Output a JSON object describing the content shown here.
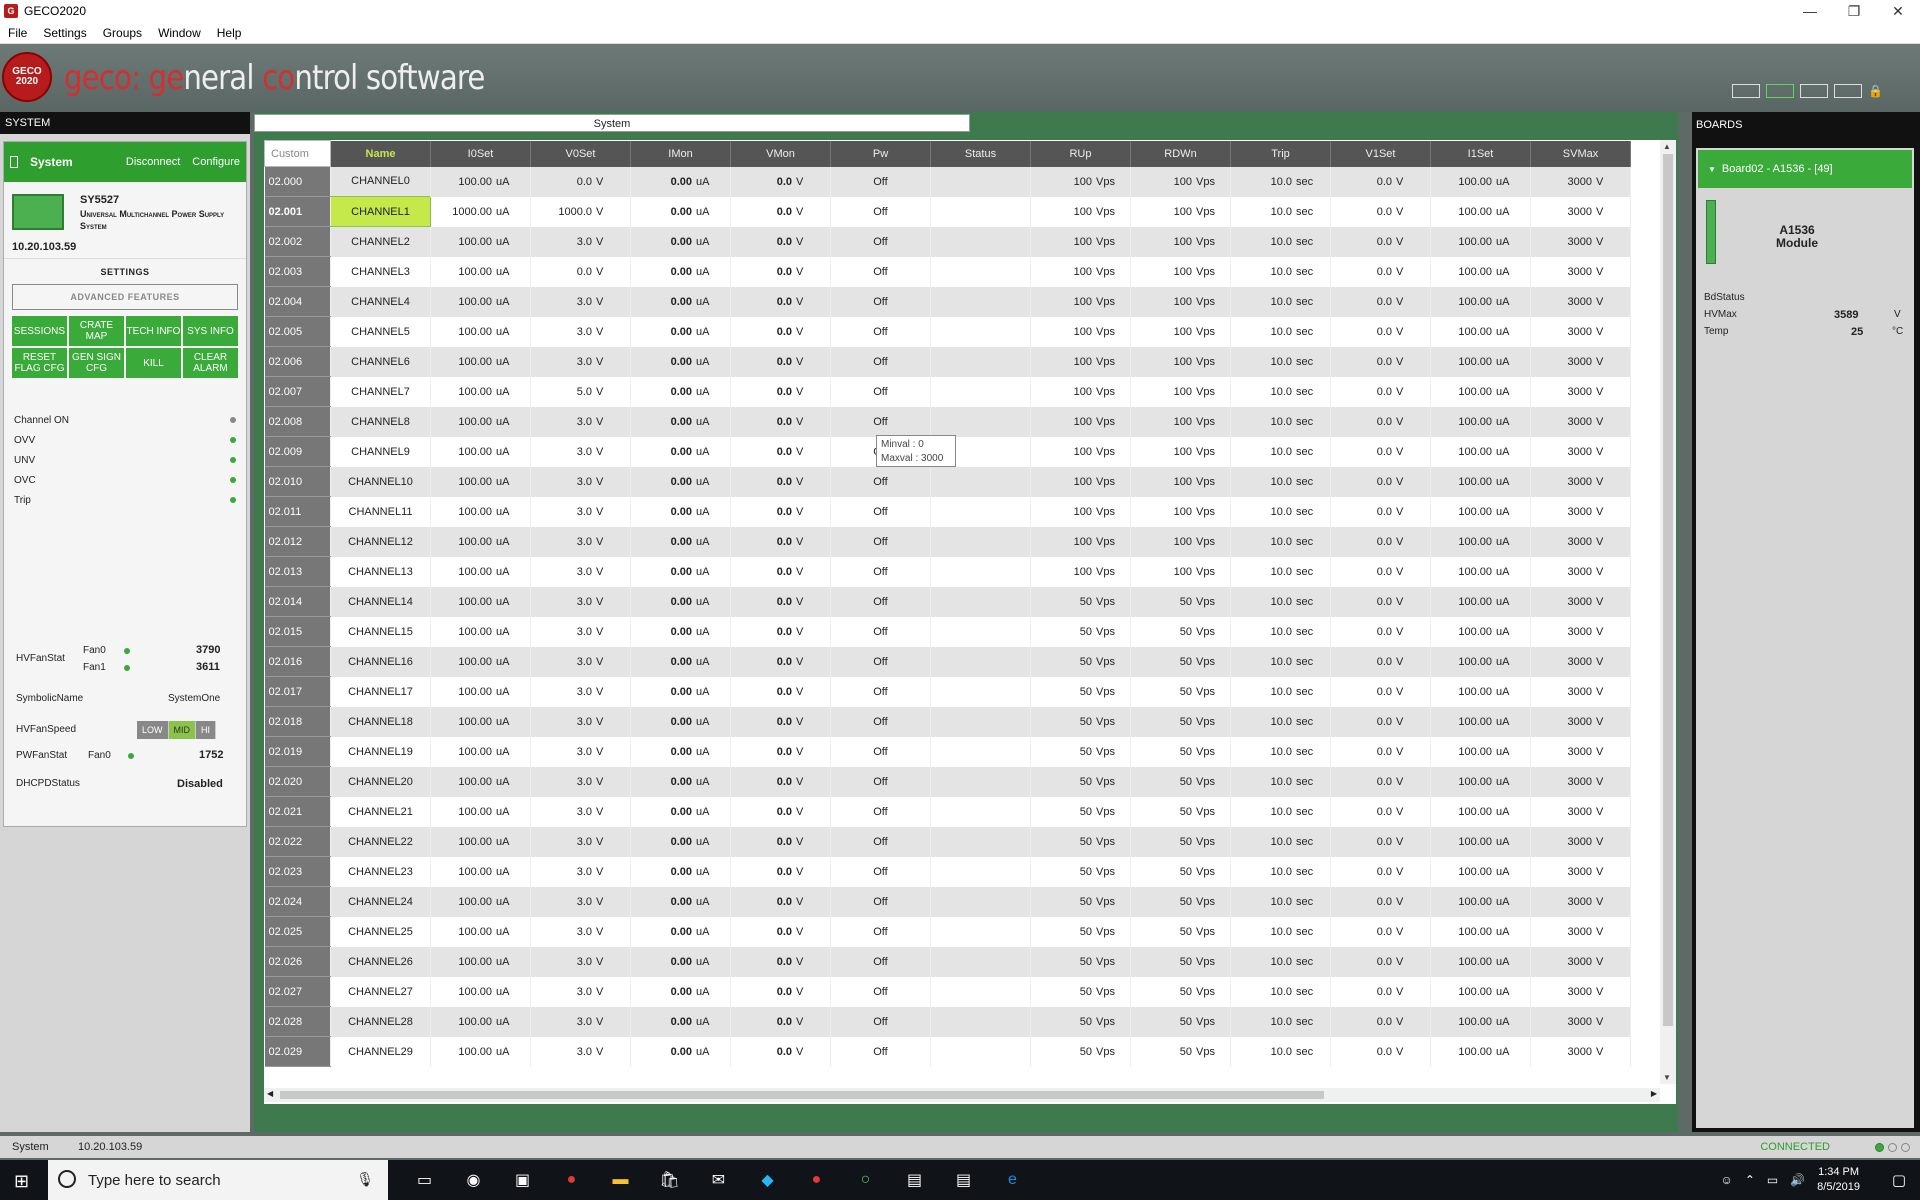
{
  "window": {
    "title": "GECO2020",
    "app_icon": "geco-app-icon"
  },
  "menu": [
    "File",
    "Settings",
    "Groups",
    "Window",
    "Help"
  ],
  "banner": {
    "logo_text": "GECO 2020",
    "title_a": "geco: ge",
    "title_b": "neral ",
    "title_c": "co",
    "title_d": "ntrol software"
  },
  "left": {
    "panel_title": "SYSTEM",
    "system_name": "System",
    "disconnect": "Disconnect",
    "configure": "Configure",
    "model": "SY5527",
    "model_desc": "Universal Multichannel Power Supply System",
    "ip": "10.20.103.59",
    "settings": "SETTINGS",
    "advanced": "ADVANCED FEATURES",
    "buttons": [
      "SESSIONS",
      "CRATE MAP",
      "TECH INFO",
      "SYS INFO",
      "RESET FLAG CFG",
      "GEN SIGN CFG",
      "KILL",
      "CLEAR ALARM"
    ],
    "flags": [
      "Channel ON",
      "OVV",
      "UNV",
      "OVC",
      "Trip"
    ],
    "hvfanstat": "HVFanStat",
    "fan0": "Fan0",
    "fan0_val": "3790",
    "fan1": "Fan1",
    "fan1_val": "3611",
    "symbolic_name_label": "SymbolicName",
    "symbolic_name": "SystemOne",
    "hvfanspeed": "HVFanSpeed",
    "speeds": [
      "LOW",
      "MID",
      "HI"
    ],
    "pwfanstat": "PWFanStat",
    "pw_fan0": "Fan0",
    "pw_fan0_val": "1752",
    "dhcp_label": "DHCPDStatus",
    "dhcp": "Disabled"
  },
  "center": {
    "tab": "System",
    "custom_placeholder": "Custom",
    "columns": [
      "Name",
      "I0Set",
      "V0Set",
      "IMon",
      "VMon",
      "Pw",
      "Status",
      "RUp",
      "RDWn",
      "Trip",
      "V1Set",
      "I1Set",
      "SVMax"
    ],
    "tooltip": [
      "Minval : 0",
      "Maxval : 3000"
    ],
    "rows": [
      [
        "02.000",
        "CHANNEL0",
        "100.00",
        "uA",
        "0.0",
        "V",
        "0.00",
        "uA",
        "0.0",
        "V",
        "Off",
        "",
        "100",
        "Vps",
        "100",
        "Vps",
        "10.0",
        "sec",
        "0.0",
        "V",
        "100.00",
        "uA",
        "3000",
        "V"
      ],
      [
        "02.001",
        "CHANNEL1",
        "1000.00",
        "uA",
        "1000.0",
        "V",
        "0.00",
        "uA",
        "0.0",
        "V",
        "Off",
        "",
        "100",
        "Vps",
        "100",
        "Vps",
        "10.0",
        "sec",
        "0.0",
        "V",
        "100.00",
        "uA",
        "3000",
        "V"
      ],
      [
        "02.002",
        "CHANNEL2",
        "100.00",
        "uA",
        "3.0",
        "V",
        "0.00",
        "uA",
        "0.0",
        "V",
        "Off",
        "",
        "100",
        "Vps",
        "100",
        "Vps",
        "10.0",
        "sec",
        "0.0",
        "V",
        "100.00",
        "uA",
        "3000",
        "V"
      ],
      [
        "02.003",
        "CHANNEL3",
        "100.00",
        "uA",
        "0.0",
        "V",
        "0.00",
        "uA",
        "0.0",
        "V",
        "Off",
        "",
        "100",
        "Vps",
        "100",
        "Vps",
        "10.0",
        "sec",
        "0.0",
        "V",
        "100.00",
        "uA",
        "3000",
        "V"
      ],
      [
        "02.004",
        "CHANNEL4",
        "100.00",
        "uA",
        "3.0",
        "V",
        "0.00",
        "uA",
        "0.0",
        "V",
        "Off",
        "",
        "100",
        "Vps",
        "100",
        "Vps",
        "10.0",
        "sec",
        "0.0",
        "V",
        "100.00",
        "uA",
        "3000",
        "V"
      ],
      [
        "02.005",
        "CHANNEL5",
        "100.00",
        "uA",
        "3.0",
        "V",
        "0.00",
        "uA",
        "0.0",
        "V",
        "Off",
        "",
        "100",
        "Vps",
        "100",
        "Vps",
        "10.0",
        "sec",
        "0.0",
        "V",
        "100.00",
        "uA",
        "3000",
        "V"
      ],
      [
        "02.006",
        "CHANNEL6",
        "100.00",
        "uA",
        "3.0",
        "V",
        "0.00",
        "uA",
        "0.0",
        "V",
        "Off",
        "",
        "100",
        "Vps",
        "100",
        "Vps",
        "10.0",
        "sec",
        "0.0",
        "V",
        "100.00",
        "uA",
        "3000",
        "V"
      ],
      [
        "02.007",
        "CHANNEL7",
        "100.00",
        "uA",
        "5.0",
        "V",
        "0.00",
        "uA",
        "0.0",
        "V",
        "Off",
        "",
        "100",
        "Vps",
        "100",
        "Vps",
        "10.0",
        "sec",
        "0.0",
        "V",
        "100.00",
        "uA",
        "3000",
        "V"
      ],
      [
        "02.008",
        "CHANNEL8",
        "100.00",
        "uA",
        "3.0",
        "V",
        "0.00",
        "uA",
        "0.0",
        "V",
        "Off",
        "",
        "100",
        "Vps",
        "100",
        "Vps",
        "10.0",
        "sec",
        "0.0",
        "V",
        "100.00",
        "uA",
        "3000",
        "V"
      ],
      [
        "02.009",
        "CHANNEL9",
        "100.00",
        "uA",
        "3.0",
        "V",
        "0.00",
        "uA",
        "0.0",
        "V",
        "Off",
        "",
        "100",
        "Vps",
        "100",
        "Vps",
        "10.0",
        "sec",
        "0.0",
        "V",
        "100.00",
        "uA",
        "3000",
        "V"
      ],
      [
        "02.010",
        "CHANNEL10",
        "100.00",
        "uA",
        "3.0",
        "V",
        "0.00",
        "uA",
        "0.0",
        "V",
        "Off",
        "",
        "100",
        "Vps",
        "100",
        "Vps",
        "10.0",
        "sec",
        "0.0",
        "V",
        "100.00",
        "uA",
        "3000",
        "V"
      ],
      [
        "02.011",
        "CHANNEL11",
        "100.00",
        "uA",
        "3.0",
        "V",
        "0.00",
        "uA",
        "0.0",
        "V",
        "Off",
        "",
        "100",
        "Vps",
        "100",
        "Vps",
        "10.0",
        "sec",
        "0.0",
        "V",
        "100.00",
        "uA",
        "3000",
        "V"
      ],
      [
        "02.012",
        "CHANNEL12",
        "100.00",
        "uA",
        "3.0",
        "V",
        "0.00",
        "uA",
        "0.0",
        "V",
        "Off",
        "",
        "100",
        "Vps",
        "100",
        "Vps",
        "10.0",
        "sec",
        "0.0",
        "V",
        "100.00",
        "uA",
        "3000",
        "V"
      ],
      [
        "02.013",
        "CHANNEL13",
        "100.00",
        "uA",
        "3.0",
        "V",
        "0.00",
        "uA",
        "0.0",
        "V",
        "Off",
        "",
        "100",
        "Vps",
        "100",
        "Vps",
        "10.0",
        "sec",
        "0.0",
        "V",
        "100.00",
        "uA",
        "3000",
        "V"
      ],
      [
        "02.014",
        "CHANNEL14",
        "100.00",
        "uA",
        "3.0",
        "V",
        "0.00",
        "uA",
        "0.0",
        "V",
        "Off",
        "",
        "50",
        "Vps",
        "50",
        "Vps",
        "10.0",
        "sec",
        "0.0",
        "V",
        "100.00",
        "uA",
        "3000",
        "V"
      ],
      [
        "02.015",
        "CHANNEL15",
        "100.00",
        "uA",
        "3.0",
        "V",
        "0.00",
        "uA",
        "0.0",
        "V",
        "Off",
        "",
        "50",
        "Vps",
        "50",
        "Vps",
        "10.0",
        "sec",
        "0.0",
        "V",
        "100.00",
        "uA",
        "3000",
        "V"
      ],
      [
        "02.016",
        "CHANNEL16",
        "100.00",
        "uA",
        "3.0",
        "V",
        "0.00",
        "uA",
        "0.0",
        "V",
        "Off",
        "",
        "50",
        "Vps",
        "50",
        "Vps",
        "10.0",
        "sec",
        "0.0",
        "V",
        "100.00",
        "uA",
        "3000",
        "V"
      ],
      [
        "02.017",
        "CHANNEL17",
        "100.00",
        "uA",
        "3.0",
        "V",
        "0.00",
        "uA",
        "0.0",
        "V",
        "Off",
        "",
        "50",
        "Vps",
        "50",
        "Vps",
        "10.0",
        "sec",
        "0.0",
        "V",
        "100.00",
        "uA",
        "3000",
        "V"
      ],
      [
        "02.018",
        "CHANNEL18",
        "100.00",
        "uA",
        "3.0",
        "V",
        "0.00",
        "uA",
        "0.0",
        "V",
        "Off",
        "",
        "50",
        "Vps",
        "50",
        "Vps",
        "10.0",
        "sec",
        "0.0",
        "V",
        "100.00",
        "uA",
        "3000",
        "V"
      ],
      [
        "02.019",
        "CHANNEL19",
        "100.00",
        "uA",
        "3.0",
        "V",
        "0.00",
        "uA",
        "0.0",
        "V",
        "Off",
        "",
        "50",
        "Vps",
        "50",
        "Vps",
        "10.0",
        "sec",
        "0.0",
        "V",
        "100.00",
        "uA",
        "3000",
        "V"
      ],
      [
        "02.020",
        "CHANNEL20",
        "100.00",
        "uA",
        "3.0",
        "V",
        "0.00",
        "uA",
        "0.0",
        "V",
        "Off",
        "",
        "50",
        "Vps",
        "50",
        "Vps",
        "10.0",
        "sec",
        "0.0",
        "V",
        "100.00",
        "uA",
        "3000",
        "V"
      ],
      [
        "02.021",
        "CHANNEL21",
        "100.00",
        "uA",
        "3.0",
        "V",
        "0.00",
        "uA",
        "0.0",
        "V",
        "Off",
        "",
        "50",
        "Vps",
        "50",
        "Vps",
        "10.0",
        "sec",
        "0.0",
        "V",
        "100.00",
        "uA",
        "3000",
        "V"
      ],
      [
        "02.022",
        "CHANNEL22",
        "100.00",
        "uA",
        "3.0",
        "V",
        "0.00",
        "uA",
        "0.0",
        "V",
        "Off",
        "",
        "50",
        "Vps",
        "50",
        "Vps",
        "10.0",
        "sec",
        "0.0",
        "V",
        "100.00",
        "uA",
        "3000",
        "V"
      ],
      [
        "02.023",
        "CHANNEL23",
        "100.00",
        "uA",
        "3.0",
        "V",
        "0.00",
        "uA",
        "0.0",
        "V",
        "Off",
        "",
        "50",
        "Vps",
        "50",
        "Vps",
        "10.0",
        "sec",
        "0.0",
        "V",
        "100.00",
        "uA",
        "3000",
        "V"
      ],
      [
        "02.024",
        "CHANNEL24",
        "100.00",
        "uA",
        "3.0",
        "V",
        "0.00",
        "uA",
        "0.0",
        "V",
        "Off",
        "",
        "50",
        "Vps",
        "50",
        "Vps",
        "10.0",
        "sec",
        "0.0",
        "V",
        "100.00",
        "uA",
        "3000",
        "V"
      ],
      [
        "02.025",
        "CHANNEL25",
        "100.00",
        "uA",
        "3.0",
        "V",
        "0.00",
        "uA",
        "0.0",
        "V",
        "Off",
        "",
        "50",
        "Vps",
        "50",
        "Vps",
        "10.0",
        "sec",
        "0.0",
        "V",
        "100.00",
        "uA",
        "3000",
        "V"
      ],
      [
        "02.026",
        "CHANNEL26",
        "100.00",
        "uA",
        "3.0",
        "V",
        "0.00",
        "uA",
        "0.0",
        "V",
        "Off",
        "",
        "50",
        "Vps",
        "50",
        "Vps",
        "10.0",
        "sec",
        "0.0",
        "V",
        "100.00",
        "uA",
        "3000",
        "V"
      ],
      [
        "02.027",
        "CHANNEL27",
        "100.00",
        "uA",
        "3.0",
        "V",
        "0.00",
        "uA",
        "0.0",
        "V",
        "Off",
        "",
        "50",
        "Vps",
        "50",
        "Vps",
        "10.0",
        "sec",
        "0.0",
        "V",
        "100.00",
        "uA",
        "3000",
        "V"
      ],
      [
        "02.028",
        "CHANNEL28",
        "100.00",
        "uA",
        "3.0",
        "V",
        "0.00",
        "uA",
        "0.0",
        "V",
        "Off",
        "",
        "50",
        "Vps",
        "50",
        "Vps",
        "10.0",
        "sec",
        "0.0",
        "V",
        "100.00",
        "uA",
        "3000",
        "V"
      ],
      [
        "02.029",
        "CHANNEL29",
        "100.00",
        "uA",
        "3.0",
        "V",
        "0.00",
        "uA",
        "0.0",
        "V",
        "Off",
        "",
        "50",
        "Vps",
        "50",
        "Vps",
        "10.0",
        "sec",
        "0.0",
        "V",
        "100.00",
        "uA",
        "3000",
        "V"
      ]
    ]
  },
  "right": {
    "panel_title": "BOARDS",
    "board": "Board02 - A1536 - [49]",
    "module_line1": "A1536",
    "module_line2": "Module",
    "bdstatus": "BdStatus",
    "hvmax_label": "HVMax",
    "hvmax": "3589",
    "hvmax_unit": "V",
    "temp_label": "Temp",
    "temp": "25",
    "temp_unit": "°C"
  },
  "status": {
    "left": "System",
    "ip": "10.20.103.59",
    "connected": "CONNECTED"
  },
  "taskbar": {
    "search": "Type here to search",
    "time": "1:34 PM",
    "date": "8/5/2019"
  },
  "colors": {
    "accent_green": "#3aaa3a",
    "selected_name": "#c5e84a",
    "header_grey": "#555555"
  }
}
